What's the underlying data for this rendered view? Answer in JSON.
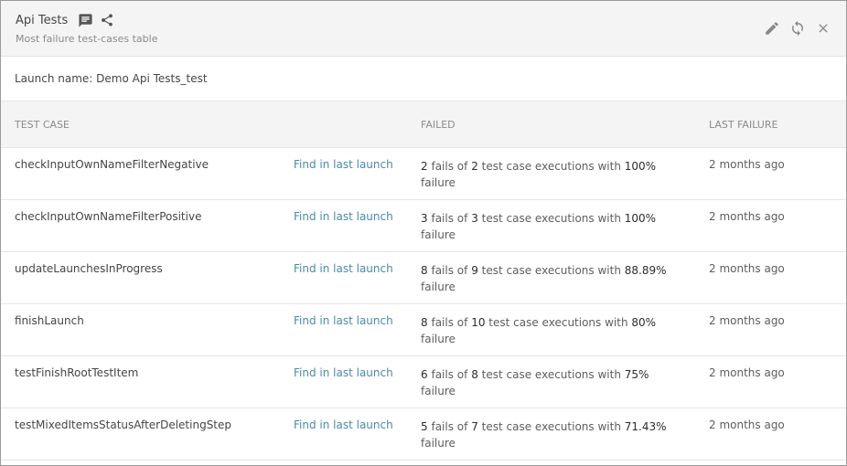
{
  "widget": {
    "title": "Api Tests",
    "subtitle": "Most failure test-cases table"
  },
  "launch": {
    "label": "Launch name: Demo Api Tests_test"
  },
  "table": {
    "columns": [
      "TEST CASE",
      "FAILED",
      "LAST FAILURE"
    ],
    "link_label": "Find in last launch",
    "fails_of": "fails of",
    "executions_with": "test case executions with",
    "failure_word": "failure",
    "rows": [
      {
        "name": "checkInputOwnNameFilterNegative",
        "fails": "2",
        "total": "2",
        "percent": "100%",
        "last": "2 months ago"
      },
      {
        "name": "checkInputOwnNameFilterPositive",
        "fails": "3",
        "total": "3",
        "percent": "100%",
        "last": "2 months ago"
      },
      {
        "name": "updateLaunchesInProgress",
        "fails": "8",
        "total": "9",
        "percent": "88.89%",
        "last": "2 months ago"
      },
      {
        "name": "finishLaunch",
        "fails": "8",
        "total": "10",
        "percent": "80%",
        "last": "2 months ago"
      },
      {
        "name": "testFinishRootTestItem",
        "fails": "6",
        "total": "8",
        "percent": "75%",
        "last": "2 months ago"
      },
      {
        "name": "testMixedItemsStatusAfterDeletingStep",
        "fails": "5",
        "total": "7",
        "percent": "71.43%",
        "last": "2 months ago"
      }
    ]
  },
  "icons": {
    "description": "comment-icon",
    "share": "share-icon",
    "edit": "pencil-icon",
    "refresh": "refresh-icon",
    "close": "close-icon"
  },
  "colors": {
    "header_bg": "#f4f4f4",
    "link": "#4a8aa8",
    "text": "#464547",
    "muted": "#8b8b8b"
  }
}
